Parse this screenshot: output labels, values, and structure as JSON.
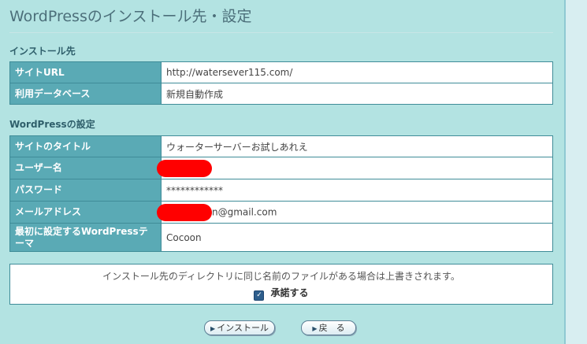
{
  "page": {
    "title": "WordPressのインストール先・設定"
  },
  "install_section": {
    "label": "インストール先",
    "rows": [
      {
        "label": "サイトURL",
        "value": "http://watersever115.com/"
      },
      {
        "label": "利用データベース",
        "value": "新規自動作成"
      }
    ]
  },
  "wp_section": {
    "label": "WordPressの設定",
    "site_title": {
      "label": "サイトのタイトル",
      "value": "ウォーターサーバーお試しあれえ"
    },
    "username": {
      "label": "ユーザー名",
      "value": ""
    },
    "password": {
      "label": "パスワード",
      "value": "************"
    },
    "email": {
      "label": "メールアドレス",
      "value": "n@gmail.com"
    },
    "theme": {
      "label": "最初に設定するWordPressテーマ",
      "value": "Cocoon"
    }
  },
  "notice": {
    "text": "インストール先のディレクトリに同じ名前のファイルがある場合は上書きされます。",
    "checkbox_label": "承諾する",
    "checked": true
  },
  "buttons": {
    "install": "インストール",
    "back": "戻　る"
  },
  "colors": {
    "background": "#b3e3e2",
    "label_cell": "#5aaab5",
    "border": "#3f8c98",
    "redaction": "#ff0000"
  }
}
